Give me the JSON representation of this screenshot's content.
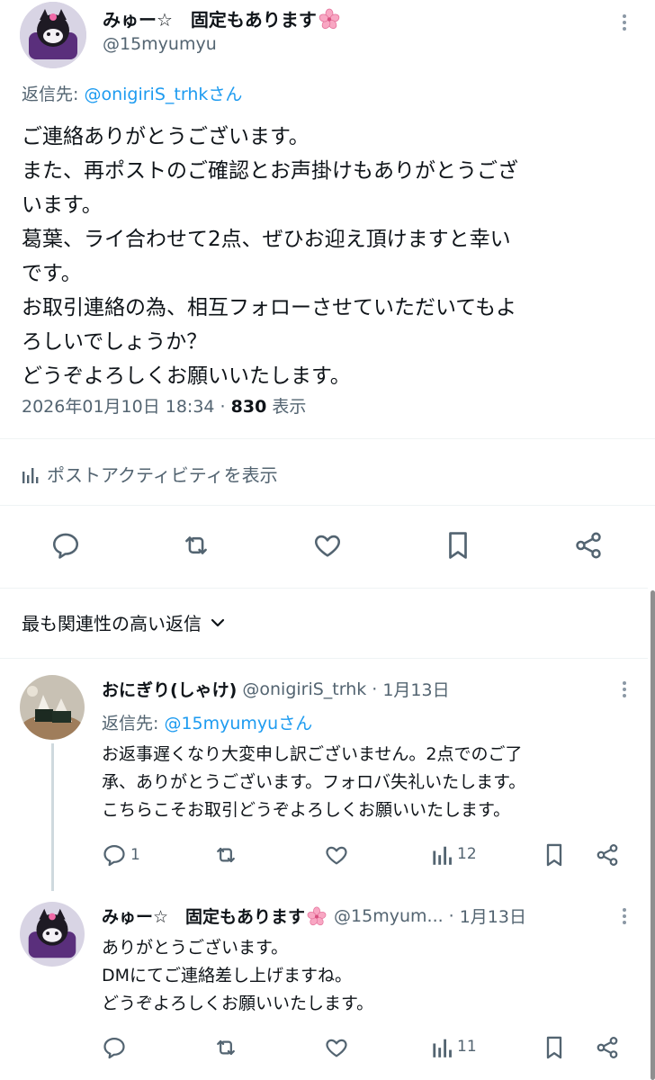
{
  "main_post": {
    "display_name": "みゅー☆　固定もあります",
    "handle": "@15myumyu",
    "reply_to_prefix": "返信先: ",
    "reply_to_handle": "@onigiriS_trhk",
    "reply_to_suffix": "さん",
    "body_lines": [
      "ご連絡ありがとうございます。",
      "また、再ポストのご確認とお声掛けもありがとうござ",
      "います。",
      "葛葉、ライ合わせて2点、ぜひお迎え頂けますと幸い",
      "です。",
      "お取引連絡の為、相互フォローさせていただいてもよ",
      "ろしいでしょうか？",
      "どうぞよろしくお願いいたします。"
    ],
    "timestamp": "2026年01月10日 18:34 · ",
    "views_count": "830",
    "views_label": " 表示",
    "activity_label": "ポストアクティビティを表示"
  },
  "sort_label": "最も関連性の高い返信",
  "replies": [
    {
      "display_name": "おにぎり(しゃけ)",
      "handle": "@onigiriS_trhk",
      "date": "1月13日",
      "reply_to_prefix": "返信先: ",
      "reply_to_handle": "@15myumyu",
      "reply_to_suffix": "さん",
      "body_lines": [
        "お返事遅くなり大変申し訳ございません。2点でのご了",
        "承、ありがとうございます。フォロバ失礼いたします。",
        "こちらこそお取引どうぞよろしくお願いいたします。"
      ],
      "reply_count": "1",
      "views_count": "12"
    },
    {
      "display_name": "みゅー☆　固定もあります",
      "handle": "@15myum...",
      "date": "1月13日",
      "body_lines": [
        "ありがとうございます。",
        "DMにてご連絡差し上げますね。",
        "どうぞよろしくお願いいたします。"
      ],
      "views_count": "11"
    }
  ],
  "colors": {
    "link": "#1d9bf0",
    "muted": "#536471",
    "text": "#0f1419",
    "divider": "#eff3f4"
  },
  "icons": [
    "more-icon",
    "sakura-icon",
    "analytics-icon",
    "reply-icon",
    "repost-icon",
    "like-icon",
    "bookmark-icon",
    "share-icon",
    "chevron-down-icon",
    "views-icon"
  ]
}
